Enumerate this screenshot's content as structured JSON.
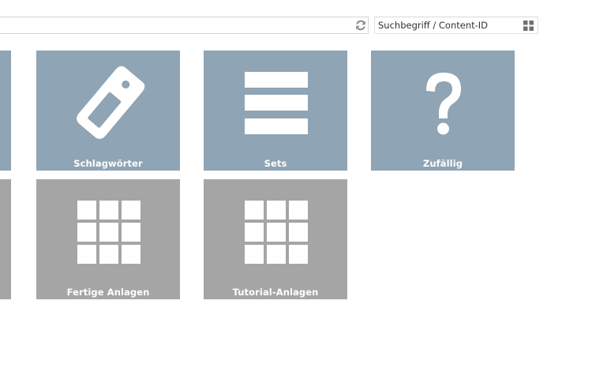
{
  "toolbar": {
    "refresh_icon": "refresh-icon",
    "search_placeholder": "Suchbegriff / Content-ID",
    "view_toggle_icon": "grid-view-icon"
  },
  "tiles_row1": [
    {
      "label": "",
      "icon": "partial-tile",
      "color": "#8fa4b4"
    },
    {
      "label": "Schlagwörter",
      "icon": "tag-icon",
      "color": "#8fa4b4"
    },
    {
      "label": "Sets",
      "icon": "list-icon",
      "color": "#8fa4b4"
    },
    {
      "label": "Zufällig",
      "icon": "question-mark-icon",
      "color": "#8fa4b4"
    }
  ],
  "tiles_row2": [
    {
      "label": "",
      "icon": "partial-tile",
      "color": "#a5a5a5"
    },
    {
      "label": "Fertige Anlagen",
      "icon": "grid-icon",
      "color": "#a5a5a5"
    },
    {
      "label": "Tutorial-Anlagen",
      "icon": "grid-icon",
      "color": "#a5a5a5"
    }
  ]
}
